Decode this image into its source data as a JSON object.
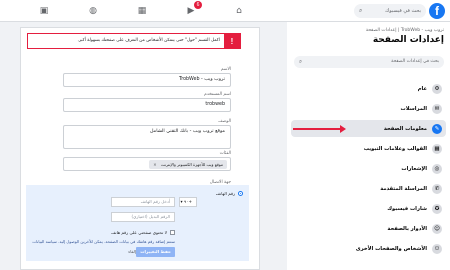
{
  "topbar": {
    "logo_letter": "f",
    "search_placeholder": "بحث في فيسبوك",
    "notification_count": "6",
    "nav_icons": [
      "home-icon",
      "watch-icon",
      "marketplace-icon",
      "groups-icon",
      "gaming-icon"
    ]
  },
  "sidebar": {
    "breadcrumb": "تروب ويب - TrobWeb | إعدادات الصفحة",
    "title": "إعدادات الصفحة",
    "search_placeholder": "بحث في إعدادات الصفحة",
    "items": [
      {
        "label": "عام",
        "icon": "gear-icon"
      },
      {
        "label": "المراسلات",
        "icon": "chat-icon"
      },
      {
        "label": "معلومات الصفحة",
        "icon": "pencil-icon",
        "active": true
      },
      {
        "label": "القوالب وعلامات التبويب",
        "icon": "grid-icon"
      },
      {
        "label": "الإشعارات",
        "icon": "globe-icon"
      },
      {
        "label": "المراسلة المتقدمة",
        "icon": "messenger-icon"
      },
      {
        "label": "شارات فيسبوك",
        "icon": "badge-icon"
      },
      {
        "label": "الأدوار بالصفحة",
        "icon": "person-icon"
      },
      {
        "label": "الأشخاص والصفحات الأخرى",
        "icon": "people-icon"
      }
    ]
  },
  "main": {
    "alert_text": "اكمل القسم \"حول\" حتى يتمكن الأشخاص من التعرف على صفحتك بسهولة أكبر.",
    "name_label": "الاسم",
    "name_value": "تروب ويب - TrobWeb",
    "username_label": "اسم المستخدم",
    "username_value": "trobweb",
    "description_label": "الوصف",
    "description_value": "موقع تروب ويب - بانك التقني الشامل",
    "categories_label": "الفئات",
    "category_chip": "موقع ويب للأجهزة الكمبيوتر والإنترنت",
    "contact_label": "جهة الاتصال",
    "phone_label": "رقم الهاتف",
    "country_code": "+٩٠",
    "phone_placeholder": "أدخل رقم الهاتف",
    "alt_number_placeholder": "الرقم البديل (اختياري)",
    "no_phone_text": "لا تحتوي صفحتي على رقم هاتف",
    "policy_text": "ستتم إضافة رقم هاتفك في بيانات الصفحة. يمكن للآخرين الوصول إليه. سياسة البيانات",
    "save_label": "حفظ التغييرات",
    "cancel_label": "إلغاء"
  }
}
